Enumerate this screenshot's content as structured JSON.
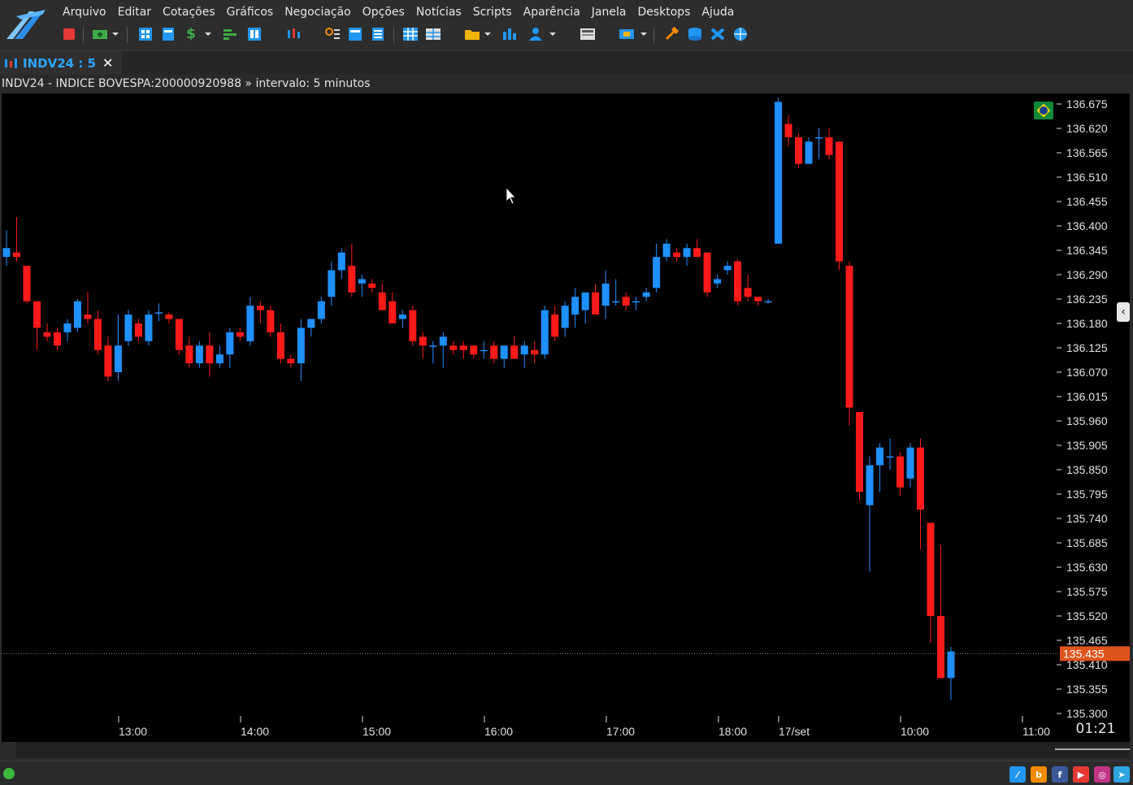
{
  "menu": [
    "Arquivo",
    "Editar",
    "Cotações",
    "Gráficos",
    "Negociação",
    "Opções",
    "Notícias",
    "Scripts",
    "Aparência",
    "Janela",
    "Desktops",
    "Ajuda"
  ],
  "tab": {
    "label": "INDV24 : 5",
    "close": "✕"
  },
  "info": "INDV24 - INDICE BOVESPA:200000920988 » intervalo: 5 minutos",
  "clock": "01:21",
  "colors": {
    "up": "#1e90ff",
    "down": "#ff1a1a",
    "last_price_bg": "#e0541b"
  },
  "last_price": "135.435",
  "chart_data": {
    "type": "candlestick",
    "interval": "5 minutos",
    "y_ticks": [
      "136.675",
      "136.620",
      "136.565",
      "136.510",
      "136.455",
      "136.400",
      "136.345",
      "136.290",
      "136.235",
      "136.180",
      "136.125",
      "136.070",
      "136.015",
      "135.960",
      "135.905",
      "135.850",
      "135.795",
      "135.740",
      "135.685",
      "135.630",
      "135.575",
      "135.520",
      "135.465",
      "135.410",
      "135.355",
      "135.300"
    ],
    "ylim": [
      135300,
      136690
    ],
    "x_ticks": [
      "13:00",
      "14:00",
      "15:00",
      "16:00",
      "17:00",
      "18:00",
      "17/set",
      "10:00",
      "11:00"
    ],
    "last": 135435,
    "candles": [
      {
        "o": 136330,
        "h": 136390,
        "l": 136310,
        "c": 136350
      },
      {
        "o": 136340,
        "h": 136420,
        "l": 136320,
        "c": 136330
      },
      {
        "o": 136310,
        "h": 136310,
        "l": 136225,
        "c": 136230
      },
      {
        "o": 136230,
        "h": 136230,
        "l": 136120,
        "c": 136170
      },
      {
        "o": 136160,
        "h": 136180,
        "l": 136140,
        "c": 136150
      },
      {
        "o": 136160,
        "h": 136170,
        "l": 136120,
        "c": 136130
      },
      {
        "o": 136160,
        "h": 136190,
        "l": 136140,
        "c": 136180
      },
      {
        "o": 136170,
        "h": 136235,
        "l": 136160,
        "c": 136230
      },
      {
        "o": 136200,
        "h": 136250,
        "l": 136180,
        "c": 136190
      },
      {
        "o": 136190,
        "h": 136210,
        "l": 136110,
        "c": 136120
      },
      {
        "o": 136130,
        "h": 136150,
        "l": 136050,
        "c": 136060
      },
      {
        "o": 136070,
        "h": 136200,
        "l": 136050,
        "c": 136130
      },
      {
        "o": 136140,
        "h": 136210,
        "l": 136130,
        "c": 136200
      },
      {
        "o": 136180,
        "h": 136190,
        "l": 136140,
        "c": 136150
      },
      {
        "o": 136140,
        "h": 136210,
        "l": 136130,
        "c": 136200
      },
      {
        "o": 136205,
        "h": 136225,
        "l": 136185,
        "c": 136205
      },
      {
        "o": 136200,
        "h": 136205,
        "l": 136180,
        "c": 136190
      },
      {
        "o": 136190,
        "h": 136190,
        "l": 136110,
        "c": 136120
      },
      {
        "o": 136130,
        "h": 136150,
        "l": 136080,
        "c": 136090
      },
      {
        "o": 136090,
        "h": 136140,
        "l": 136080,
        "c": 136130
      },
      {
        "o": 136130,
        "h": 136160,
        "l": 136060,
        "c": 136090
      },
      {
        "o": 136090,
        "h": 136130,
        "l": 136080,
        "c": 136110
      },
      {
        "o": 136110,
        "h": 136170,
        "l": 136080,
        "c": 136160
      },
      {
        "o": 136160,
        "h": 136170,
        "l": 136140,
        "c": 136150
      },
      {
        "o": 136140,
        "h": 136240,
        "l": 136130,
        "c": 136220
      },
      {
        "o": 136220,
        "h": 136230,
        "l": 136180,
        "c": 136210
      },
      {
        "o": 136210,
        "h": 136220,
        "l": 136150,
        "c": 136160
      },
      {
        "o": 136160,
        "h": 136180,
        "l": 136090,
        "c": 136100
      },
      {
        "o": 136100,
        "h": 136110,
        "l": 136080,
        "c": 136090
      },
      {
        "o": 136090,
        "h": 136190,
        "l": 136050,
        "c": 136170
      },
      {
        "o": 136170,
        "h": 136190,
        "l": 136150,
        "c": 136190
      },
      {
        "o": 136190,
        "h": 136240,
        "l": 136180,
        "c": 136230
      },
      {
        "o": 136240,
        "h": 136320,
        "l": 136220,
        "c": 136300
      },
      {
        "o": 136300,
        "h": 136350,
        "l": 136280,
        "c": 136340
      },
      {
        "o": 136310,
        "h": 136360,
        "l": 136240,
        "c": 136250
      },
      {
        "o": 136270,
        "h": 136290,
        "l": 136240,
        "c": 136280
      },
      {
        "o": 136270,
        "h": 136280,
        "l": 136250,
        "c": 136260
      },
      {
        "o": 136250,
        "h": 136270,
        "l": 136210,
        "c": 136210
      },
      {
        "o": 136230,
        "h": 136250,
        "l": 136180,
        "c": 136180
      },
      {
        "o": 136190,
        "h": 136210,
        "l": 136170,
        "c": 136200
      },
      {
        "o": 136210,
        "h": 136220,
        "l": 136130,
        "c": 136140
      },
      {
        "o": 136150,
        "h": 136160,
        "l": 136100,
        "c": 136130
      },
      {
        "o": 136130,
        "h": 136140,
        "l": 136090,
        "c": 136130
      },
      {
        "o": 136130,
        "h": 136160,
        "l": 136080,
        "c": 136150
      },
      {
        "o": 136130,
        "h": 136140,
        "l": 136110,
        "c": 136120
      },
      {
        "o": 136130,
        "h": 136140,
        "l": 136100,
        "c": 136120
      },
      {
        "o": 136130,
        "h": 136130,
        "l": 136100,
        "c": 136110
      },
      {
        "o": 136120,
        "h": 136140,
        "l": 136100,
        "c": 136120
      },
      {
        "o": 136130,
        "h": 136140,
        "l": 136090,
        "c": 136100
      },
      {
        "o": 136100,
        "h": 136120,
        "l": 136080,
        "c": 136130
      },
      {
        "o": 136130,
        "h": 136150,
        "l": 136100,
        "c": 136100
      },
      {
        "o": 136110,
        "h": 136140,
        "l": 136080,
        "c": 136130
      },
      {
        "o": 136120,
        "h": 136140,
        "l": 136090,
        "c": 136110
      },
      {
        "o": 136110,
        "h": 136220,
        "l": 136100,
        "c": 136210
      },
      {
        "o": 136200,
        "h": 136220,
        "l": 136140,
        "c": 136150
      },
      {
        "o": 136170,
        "h": 136230,
        "l": 136150,
        "c": 136220
      },
      {
        "o": 136200,
        "h": 136260,
        "l": 136170,
        "c": 136240
      },
      {
        "o": 136210,
        "h": 136250,
        "l": 136180,
        "c": 136250
      },
      {
        "o": 136250,
        "h": 136270,
        "l": 136200,
        "c": 136200
      },
      {
        "o": 136220,
        "h": 136300,
        "l": 136190,
        "c": 136270
      },
      {
        "o": 136230,
        "h": 136280,
        "l": 136220,
        "c": 136230
      },
      {
        "o": 136240,
        "h": 136250,
        "l": 136210,
        "c": 136220
      },
      {
        "o": 136230,
        "h": 136240,
        "l": 136210,
        "c": 136230
      },
      {
        "o": 136240,
        "h": 136260,
        "l": 136230,
        "c": 136250
      },
      {
        "o": 136260,
        "h": 136360,
        "l": 136250,
        "c": 136330
      },
      {
        "o": 136330,
        "h": 136370,
        "l": 136320,
        "c": 136360
      },
      {
        "o": 136340,
        "h": 136350,
        "l": 136320,
        "c": 136330
      },
      {
        "o": 136330,
        "h": 136360,
        "l": 136310,
        "c": 136350
      },
      {
        "o": 136350,
        "h": 136370,
        "l": 136330,
        "c": 136330
      },
      {
        "o": 136340,
        "h": 136340,
        "l": 136240,
        "c": 136250
      },
      {
        "o": 136270,
        "h": 136290,
        "l": 136260,
        "c": 136280
      },
      {
        "o": 136300,
        "h": 136320,
        "l": 136290,
        "c": 136310
      },
      {
        "o": 136320,
        "h": 136325,
        "l": 136220,
        "c": 136230
      },
      {
        "o": 136260,
        "h": 136290,
        "l": 136230,
        "c": 136240
      },
      {
        "o": 136240,
        "h": 136240,
        "l": 136220,
        "c": 136230
      },
      {
        "o": 136230,
        "h": 136235,
        "l": 136225,
        "c": 136230
      },
      {
        "o": 136360,
        "h": 136690,
        "l": 136360,
        "c": 136680
      },
      {
        "o": 136630,
        "h": 136650,
        "l": 136580,
        "c": 136600
      },
      {
        "o": 136600,
        "h": 136610,
        "l": 136530,
        "c": 136540
      },
      {
        "o": 136540,
        "h": 136600,
        "l": 136540,
        "c": 136590
      },
      {
        "o": 136600,
        "h": 136620,
        "l": 136550,
        "c": 136600
      },
      {
        "o": 136600,
        "h": 136620,
        "l": 136550,
        "c": 136560
      },
      {
        "o": 136590,
        "h": 136590,
        "l": 136300,
        "c": 136320
      },
      {
        "o": 136310,
        "h": 136320,
        "l": 135950,
        "c": 135990
      },
      {
        "o": 135980,
        "h": 135980,
        "l": 135780,
        "c": 135800
      },
      {
        "o": 135770,
        "h": 135880,
        "l": 135620,
        "c": 135860
      },
      {
        "o": 135860,
        "h": 135910,
        "l": 135800,
        "c": 135900
      },
      {
        "o": 135880,
        "h": 135920,
        "l": 135850,
        "c": 135880
      },
      {
        "o": 135880,
        "h": 135890,
        "l": 135790,
        "c": 135810
      },
      {
        "o": 135830,
        "h": 135910,
        "l": 135810,
        "c": 135900
      },
      {
        "o": 135900,
        "h": 135920,
        "l": 135670,
        "c": 135760
      },
      {
        "o": 135730,
        "h": 135730,
        "l": 135460,
        "c": 135520
      },
      {
        "o": 135520,
        "h": 135680,
        "l": 135390,
        "c": 135380
      },
      {
        "o": 135380,
        "h": 135450,
        "l": 135330,
        "c": 135440
      }
    ]
  }
}
